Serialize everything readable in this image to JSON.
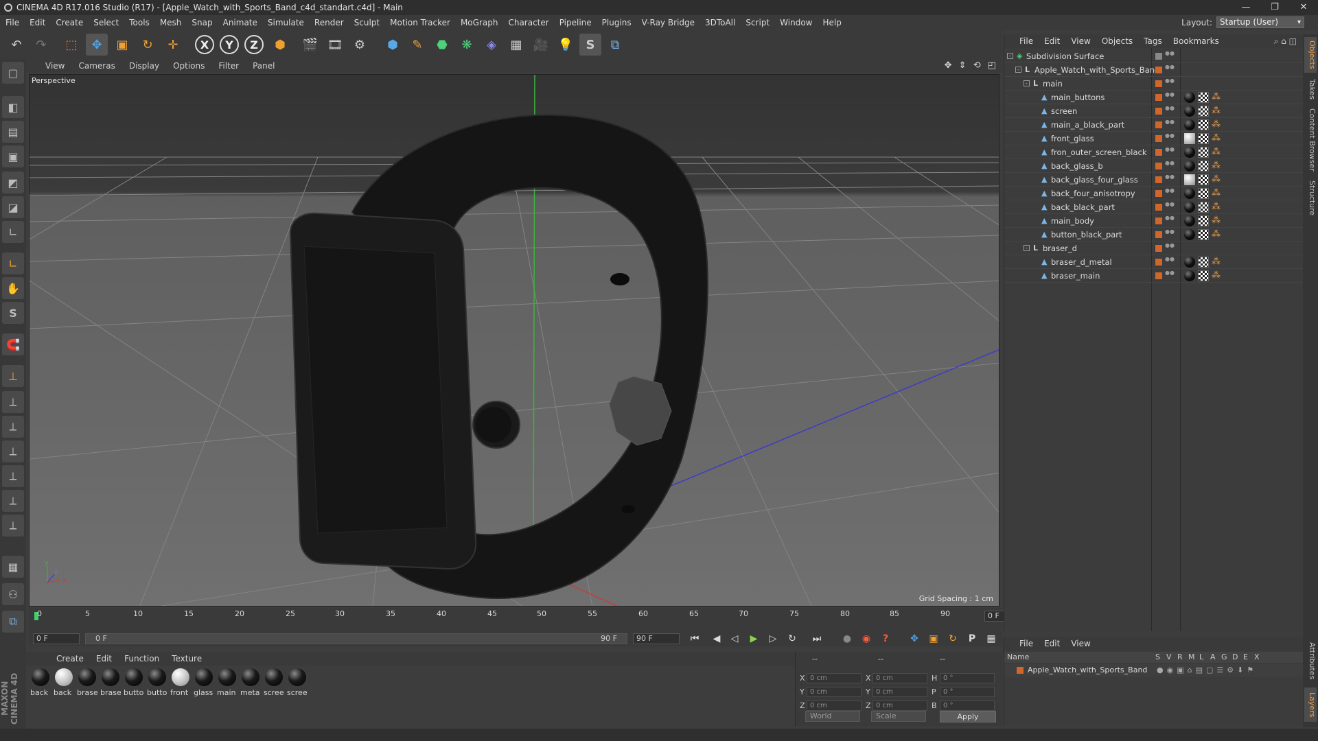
{
  "window": {
    "title": "CINEMA 4D R17.016 Studio (R17) - [Apple_Watch_with_Sports_Band_c4d_standart.c4d] - Main",
    "minimize": "—",
    "restore": "❐",
    "close": "✕"
  },
  "menu": [
    "File",
    "Edit",
    "Create",
    "Select",
    "Tools",
    "Mesh",
    "Snap",
    "Animate",
    "Simulate",
    "Render",
    "Sculpt",
    "Motion Tracker",
    "MoGraph",
    "Character",
    "Pipeline",
    "Plugins",
    "V-Ray Bridge",
    "3DToAll",
    "Script",
    "Window",
    "Help"
  ],
  "layout": {
    "label": "Layout:",
    "value": "Startup (User)"
  },
  "toolbar": {
    "undo": "↶",
    "redo": "↷",
    "select": "⬚",
    "move": "✥",
    "scale": "▣",
    "rotate": "↻",
    "last_tool": "✛",
    "axis_x": "X",
    "axis_y": "Y",
    "axis_z": "Z",
    "coord_system": "⬢",
    "render_view": "🎬",
    "render_picture": "🎞",
    "render_settings": "⚙",
    "cube": "⬢",
    "pen": "✎",
    "subdivision": "⬣",
    "cloner": "❋",
    "deformer": "◈",
    "floor": "▦",
    "camera": "🎥",
    "light": "💡",
    "snap_icon": "S",
    "python": "⧉"
  },
  "leftbar": [
    "▢",
    "◧",
    "▤",
    "▣",
    "◩",
    "◪",
    "∟",
    "✋",
    "S",
    "🧲",
    "⊥",
    "⟂",
    "⟂",
    "⟂",
    "⟂",
    "⟂",
    "⟂",
    "▦",
    "⚇",
    "⧉"
  ],
  "maxon_logo": "MAXON CINEMA 4D",
  "viewport": {
    "menu": [
      "View",
      "Cameras",
      "Display",
      "Options",
      "Filter",
      "Panel"
    ],
    "nav": "✥ ⇕ ⟲ ◰",
    "label": "Perspective",
    "grid_spacing": "Grid Spacing : 1 cm",
    "axis_x": "x",
    "axis_y": "y",
    "axis_z": "z"
  },
  "timeline": {
    "ticks": [
      "0",
      "5",
      "10",
      "15",
      "20",
      "25",
      "30",
      "35",
      "40",
      "45",
      "50",
      "55",
      "60",
      "65",
      "70",
      "75",
      "80",
      "85",
      "90"
    ],
    "current_frame": "0 F",
    "start_field": "0 F",
    "range_start": "0 F",
    "range_end": "90 F",
    "end_field": "90 F"
  },
  "transport": {
    "first": "⏮",
    "prev_key": "◀",
    "prev_frame": "◁",
    "play": "▶",
    "next_frame": "▷",
    "next_key": "↻",
    "last": "⏭",
    "record": "●",
    "autokey": "◉",
    "help": "?",
    "keys_pos": "✥",
    "keys_scale": "▣",
    "keys_rot": "↻",
    "keys_param": "P",
    "keys_pla": "▦",
    "timeline_btn": "▤"
  },
  "material_manager": {
    "menu": [
      "Create",
      "Edit",
      "Function",
      "Texture"
    ],
    "materials": [
      {
        "label": "back",
        "light": false
      },
      {
        "label": "back",
        "light": true
      },
      {
        "label": "brase",
        "light": false
      },
      {
        "label": "brase",
        "light": false
      },
      {
        "label": "butto",
        "light": false
      },
      {
        "label": "butto",
        "light": false
      },
      {
        "label": "front",
        "light": true
      },
      {
        "label": "glass",
        "light": false
      },
      {
        "label": "main",
        "light": false
      },
      {
        "label": "meta",
        "light": false
      },
      {
        "label": "scree",
        "light": false
      },
      {
        "label": "scree",
        "light": false
      }
    ]
  },
  "coordinates": {
    "header_left": "--",
    "header_mid": "--",
    "header_right": "--",
    "rows": [
      {
        "axis": "X",
        "pos": "0 cm",
        "axis2": "X",
        "size": "0 cm",
        "rot_label": "H",
        "rot": "0 °"
      },
      {
        "axis": "Y",
        "pos": "0 cm",
        "axis2": "Y",
        "size": "0 cm",
        "rot_label": "P",
        "rot": "0 °"
      },
      {
        "axis": "Z",
        "pos": "0 cm",
        "axis2": "Z",
        "size": "0 cm",
        "rot_label": "B",
        "rot": "0 °"
      }
    ],
    "space": "World",
    "mode": "Scale",
    "apply": "Apply"
  },
  "object_manager": {
    "menu": [
      "File",
      "Edit",
      "View",
      "Objects",
      "Tags",
      "Bookmarks"
    ],
    "objects": [
      {
        "name": "Subdivision Surface",
        "depth": 0,
        "type": "subdiv",
        "expand": "-",
        "tags": []
      },
      {
        "name": "Apple_Watch_with_Sports_Band",
        "depth": 1,
        "type": "null",
        "expand": "-",
        "tags": []
      },
      {
        "name": "main",
        "depth": 2,
        "type": "null",
        "expand": "-",
        "tags": []
      },
      {
        "name": "main_buttons",
        "depth": 3,
        "type": "poly",
        "tags": [
          "black",
          "check",
          "phong"
        ]
      },
      {
        "name": "screen",
        "depth": 3,
        "type": "poly",
        "tags": [
          "black",
          "check",
          "phong"
        ]
      },
      {
        "name": "main_a_black_part",
        "depth": 3,
        "type": "poly",
        "tags": [
          "black",
          "check",
          "phong"
        ]
      },
      {
        "name": "front_glass",
        "depth": 3,
        "type": "poly",
        "tags": [
          "white",
          "check",
          "phong"
        ]
      },
      {
        "name": "fron_outer_screen_black",
        "depth": 3,
        "type": "poly",
        "tags": [
          "black",
          "check",
          "phong"
        ]
      },
      {
        "name": "back_glass_b",
        "depth": 3,
        "type": "poly",
        "tags": [
          "black",
          "check",
          "phong"
        ]
      },
      {
        "name": "back_glass_four_glass",
        "depth": 3,
        "type": "poly",
        "tags": [
          "white",
          "check",
          "phong"
        ]
      },
      {
        "name": "back_four_anisotropy",
        "depth": 3,
        "type": "poly",
        "tags": [
          "black",
          "check",
          "phong"
        ]
      },
      {
        "name": "back_black_part",
        "depth": 3,
        "type": "poly",
        "tags": [
          "black",
          "check",
          "phong"
        ]
      },
      {
        "name": "main_body",
        "depth": 3,
        "type": "poly",
        "tags": [
          "black",
          "check",
          "phong"
        ]
      },
      {
        "name": "button_black_part",
        "depth": 3,
        "type": "poly",
        "tags": [
          "black",
          "check",
          "phong"
        ]
      },
      {
        "name": "braser_d",
        "depth": 2,
        "type": "null",
        "expand": "-",
        "tags": []
      },
      {
        "name": "braser_d_metal",
        "depth": 3,
        "type": "poly",
        "tags": [
          "black",
          "check",
          "phong"
        ]
      },
      {
        "name": "braser_main",
        "depth": 3,
        "type": "poly",
        "tags": [
          "black",
          "check",
          "phong"
        ]
      }
    ]
  },
  "layer_manager": {
    "menu": [
      "File",
      "Edit",
      "View"
    ],
    "columns": [
      "Name",
      "S",
      "V",
      "R",
      "M",
      "L",
      "A",
      "G",
      "D",
      "E",
      "X"
    ],
    "layer_name": "Apple_Watch_with_Sports_Band"
  },
  "right_tabs": [
    "Objects",
    "Takes",
    "Content Browser",
    "Structure",
    "Attributes",
    "Layers"
  ],
  "colors": {
    "accent": "#d1662a",
    "play": "#8bd34a",
    "record": "#ff5a3c",
    "x_axis": "#c83c3c",
    "y_axis": "#3cb43c",
    "z_axis": "#3c3cc8"
  }
}
